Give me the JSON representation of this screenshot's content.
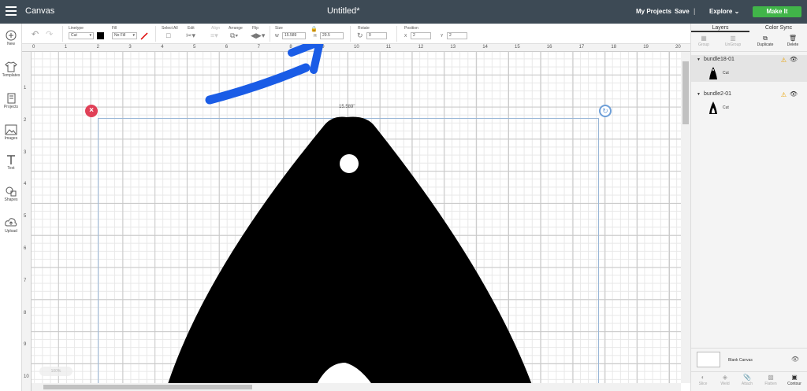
{
  "topbar": {
    "app_title": "Canvas",
    "doc_title": "Untitled*",
    "my_projects": "My Projects",
    "save": "Save",
    "separator": "|",
    "explore": "Explore",
    "make_it": "Make It"
  },
  "toolbar": {
    "linetype_label": "Linetype",
    "linetype_value": "Cut",
    "fill_label": "Fill",
    "fill_value": "No Fill",
    "select_all_label": "Select All",
    "edit_label": "Edit",
    "align_label": "Align",
    "arrange_label": "Arrange",
    "flip_label": "Flip",
    "size_label": "Size",
    "w_label": "W",
    "w_value": "15.589",
    "h_label": "H",
    "h_value": "29.5",
    "rotate_label": "Rotate",
    "rotate_value": "0",
    "position_label": "Position",
    "x_label": "X",
    "x_value": "2",
    "y_label": "Y",
    "y_value": "2"
  },
  "leftbar": {
    "items": [
      {
        "label": "New",
        "icon": "plus-icon"
      },
      {
        "label": "Templates",
        "icon": "shirt-icon"
      },
      {
        "label": "Projects",
        "icon": "projects-icon"
      },
      {
        "label": "Images",
        "icon": "image-icon"
      },
      {
        "label": "Text",
        "icon": "text-icon"
      },
      {
        "label": "Shapes",
        "icon": "shapes-icon"
      },
      {
        "label": "Upload",
        "icon": "upload-icon"
      }
    ]
  },
  "canvas": {
    "ruler_top": [
      "0",
      "1",
      "2",
      "3",
      "4",
      "5",
      "6",
      "7",
      "8",
      "9",
      "10",
      "11",
      "12",
      "13",
      "14",
      "15",
      "16",
      "17",
      "18",
      "19",
      "20"
    ],
    "ruler_left": [
      "1",
      "2",
      "3",
      "4",
      "5",
      "6",
      "7",
      "8",
      "9",
      "10"
    ],
    "width_label": "15.589\"",
    "zoom": "100%"
  },
  "rightpanel": {
    "tabs": [
      "Layers",
      "Color Sync"
    ],
    "tools": [
      {
        "label": "Group",
        "enabled": false
      },
      {
        "label": "UnGroup",
        "enabled": false
      },
      {
        "label": "Duplicate",
        "enabled": true
      },
      {
        "label": "Delete",
        "enabled": true
      }
    ],
    "layers": [
      {
        "name": "bundle18-01",
        "item": "Cut"
      },
      {
        "name": "bundle2-01",
        "item": "Cut"
      }
    ],
    "blank_canvas": "Blank Canvas",
    "bottom_tools": [
      "Slice",
      "Weld",
      "Attach",
      "Flatten",
      "Contour"
    ]
  },
  "colors": {
    "topbar": "#3d4a55",
    "make_it": "#41b549",
    "arrow": "#1a5ce6",
    "delete_handle": "#e04057",
    "rotate_handle": "#6e9fd8"
  }
}
